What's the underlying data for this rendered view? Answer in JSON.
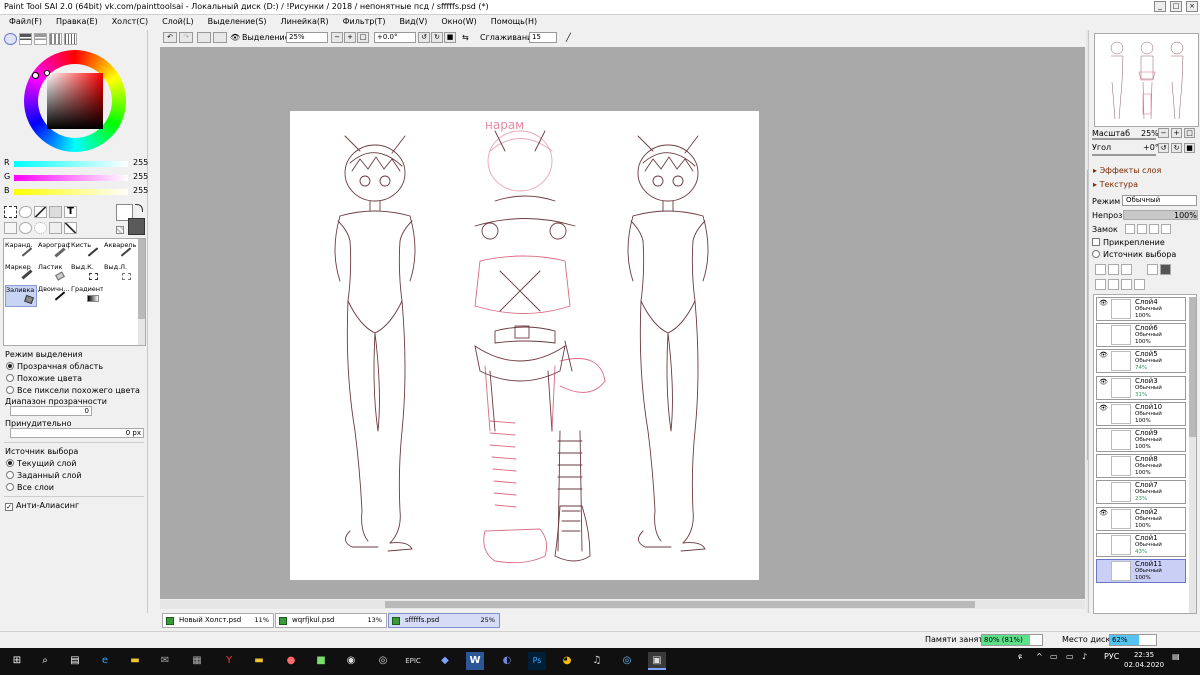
{
  "window": {
    "title": "Paint Tool SAI 2.0 (64bit) vk.com/painttoolsai - Локальный диск (D:) / !Рисунки / 2018 / непонятные псд / sfffffs.psd (*)",
    "minimize": "_",
    "maximize": "□",
    "close": "×"
  },
  "menu": [
    "Файл(F)",
    "Правка(E)",
    "Холст(C)",
    "Слой(L)",
    "Выделение(S)",
    "Линейка(R)",
    "Фильтр(T)",
    "Вид(V)",
    "Окно(W)",
    "Помощь(H)"
  ],
  "color": {
    "r_label": "R",
    "r_value": "255",
    "g_label": "G",
    "g_value": "255",
    "b_label": "B",
    "b_value": "255",
    "r_color": "#00ffff",
    "g_color": "#ff00ff",
    "b_color": "#ffff00"
  },
  "tools": [
    {
      "label": "Каранд.",
      "icon": "pencil-icon"
    },
    {
      "label": "Аэрограф",
      "icon": "airbrush-icon"
    },
    {
      "label": "Кисть",
      "icon": "brush-icon"
    },
    {
      "label": "Акварель",
      "icon": "watercolor-icon"
    },
    {
      "label": "Маркер",
      "icon": "marker-icon"
    },
    {
      "label": "Ластик",
      "icon": "eraser-icon"
    },
    {
      "label": "Выд.К.",
      "icon": "select-pen-icon"
    },
    {
      "label": "Выд.Л.",
      "icon": "select-eraser-icon"
    },
    {
      "label": "Заливка",
      "icon": "bucket-icon",
      "selected": true
    },
    {
      "label": "Двоичн...",
      "icon": "binary-pen-icon"
    },
    {
      "label": "Градиент",
      "icon": "gradient-icon"
    }
  ],
  "tool_options": {
    "selection_mode_title": "Режим выделения",
    "mode_options": [
      "Прозрачная область",
      "Похожие цвета",
      "Все пиксели похожего цвета"
    ],
    "mode_selected": 0,
    "transparency_range_label": "Диапазон прозрачности",
    "transparency_range_value": "0",
    "forced_label": "Принудительно",
    "forced_value": "0 px",
    "source_title": "Источник выбора",
    "source_options": [
      "Текущий слой",
      "Заданный слой",
      "Все слои"
    ],
    "source_selected": 0,
    "antialias_label": "Анти-Алиасинг",
    "antialias_checked": true
  },
  "toolbar": {
    "selection_label": "Выделение",
    "zoom_value": "25%",
    "angle_value": "+0.0°",
    "smoothing_label": "Сглаживание",
    "smoothing_value": "15"
  },
  "documents": [
    {
      "name": "Новый Холст.psd",
      "zoom": "11%",
      "active": false
    },
    {
      "name": "wqrfjkul.psd",
      "zoom": "13%",
      "active": false
    },
    {
      "name": "sfffffs.psd",
      "zoom": "25%",
      "active": true
    }
  ],
  "navigator": {
    "scale_label": "Масштаб",
    "scale_value": "25%",
    "angle_label": "Угол",
    "angle_value": "+0°"
  },
  "layer_panel": {
    "effects_label": "Эффекты слоя",
    "texture_label": "Текстура",
    "mode_label": "Режим",
    "mode_value": "Обычный",
    "opacity_label": "Непроз.",
    "opacity_value": "100%",
    "lock_label": "Замок",
    "clip_label": "Прикрепление",
    "source_label": "Источник выбора"
  },
  "layers": [
    {
      "name": "Слой4",
      "mode": "Обычный",
      "opacity": "100%",
      "visible": true,
      "selected": false
    },
    {
      "name": "Слой6",
      "mode": "Обычный",
      "opacity": "100%",
      "visible": false,
      "selected": false
    },
    {
      "name": "Слой5",
      "mode": "Обычный",
      "opacity": "74%",
      "visible": true,
      "selected": false
    },
    {
      "name": "Слой3",
      "mode": "Обычный",
      "opacity": "31%",
      "visible": true,
      "selected": false
    },
    {
      "name": "Слой10",
      "mode": "Обычный",
      "opacity": "100%",
      "visible": true,
      "selected": false
    },
    {
      "name": "Слой9",
      "mode": "Обычный",
      "opacity": "100%",
      "visible": false,
      "selected": false
    },
    {
      "name": "Слой8",
      "mode": "Обычный",
      "opacity": "100%",
      "visible": false,
      "selected": false
    },
    {
      "name": "Слой7",
      "mode": "Обычный",
      "opacity": "23%",
      "visible": false,
      "selected": false
    },
    {
      "name": "Слой2",
      "mode": "Обычный",
      "opacity": "100%",
      "visible": true,
      "selected": false
    },
    {
      "name": "Слой1",
      "mode": "Обычный",
      "opacity": "43%",
      "visible": false,
      "selected": false
    },
    {
      "name": "Слой11",
      "mode": "Обычный",
      "opacity": "100%",
      "visible": false,
      "selected": true
    }
  ],
  "status": {
    "memory_label": "Памяти занято",
    "memory_value": "80% (81%)",
    "memory_fraction": 0.8,
    "disk_label": "Место диска",
    "disk_value": "62%",
    "disk_fraction": 0.62
  },
  "canvas_text": "нарам",
  "taskbar": {
    "language": "РУС",
    "time": "22:35",
    "date": "02.04.2020"
  }
}
